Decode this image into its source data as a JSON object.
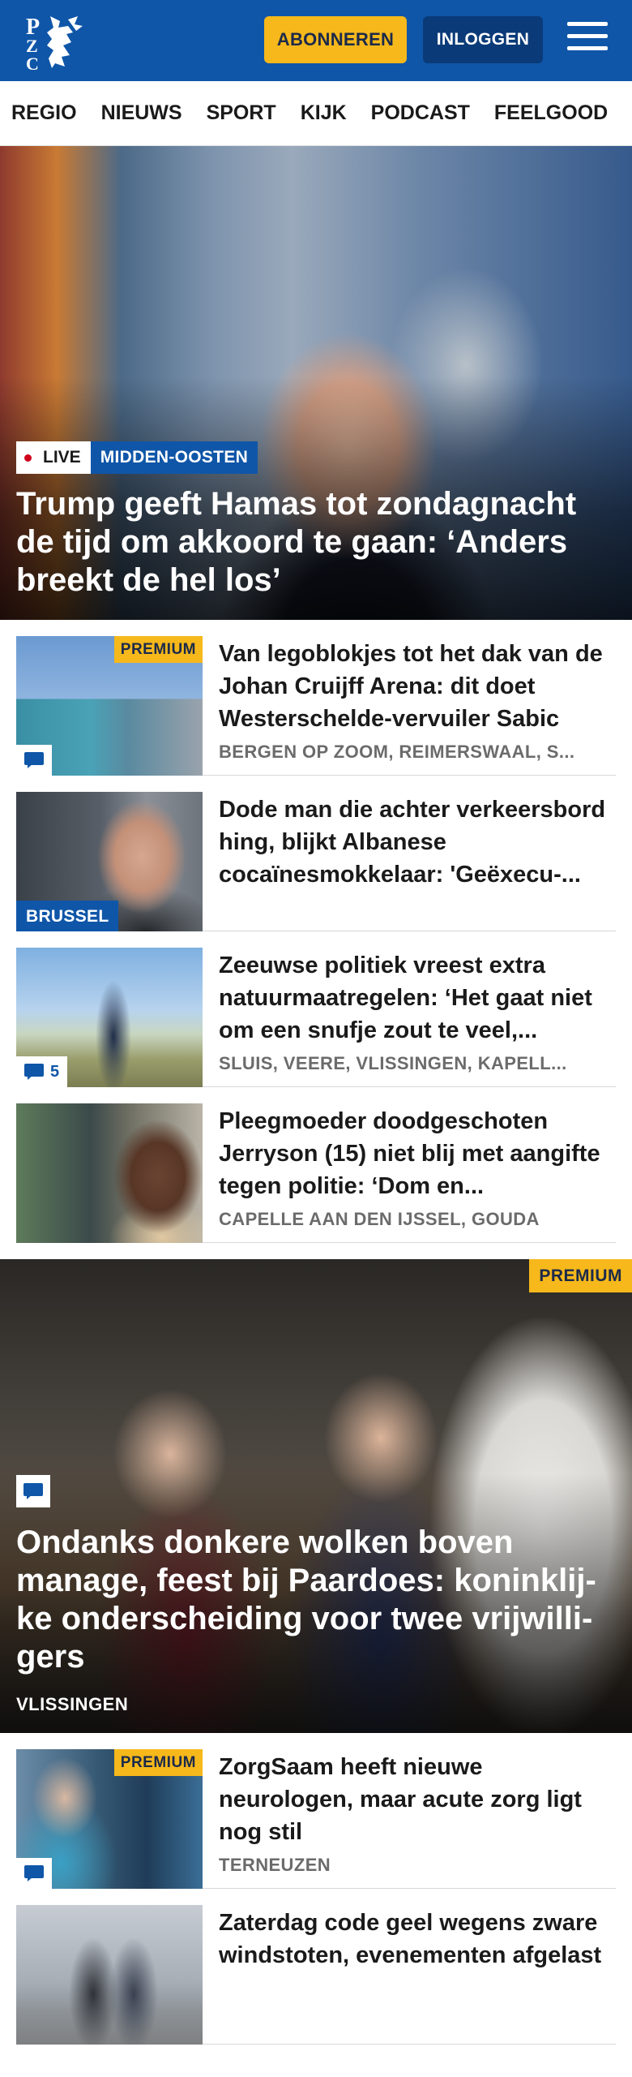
{
  "header": {
    "logo_alt": "PZC",
    "subscribe_label": "ABONNEREN",
    "login_label": "INLOGGEN"
  },
  "nav": {
    "items": [
      "REGIO",
      "NIEUWS",
      "SPORT",
      "KIJK",
      "PODCAST",
      "FEELGOOD"
    ]
  },
  "hero": {
    "live_label": "LIVE",
    "section_label": "MIDDEN-OOSTEN",
    "title": "Trump geeft Hamas tot zondagnacht de tijd om akkoord te gaan: ‘Anders breekt de hel los’"
  },
  "articles": [
    {
      "premium": "PREMIUM",
      "title": "Van legoblokjes tot het dak van de Johan Cruijff Arena: dit doet Westerschelde-vervuiler Sabic",
      "location": "BERGEN OP ZOOM, REIMERSWAAL, S..."
    },
    {
      "section": "BRUSSEL",
      "title": "Dode man die achter verkeers­bord hing, blijkt Albanese cocaïnesmokkelaar: 'Geëxecu-..."
    },
    {
      "comments": "5",
      "title": "Zeeuwse politiek vreest extra natuurmaatregelen: ‘Het gaat niet om een snufje zout te veel,...",
      "location": "SLUIS, VEERE, VLISSINGEN, KAPELL..."
    },
    {
      "title": "Pleegmoeder doodgeschoten Jerryson (15) niet blij met aangifte tegen politie: ‘Dom en...",
      "location": "CAPELLE AAN DEN IJSSEL, GOUDA"
    }
  ],
  "feature": {
    "premium": "PREMIUM",
    "title": "Ondanks donkere wolken boven manage, feest bij Paardoes: koninklij­ke onderscheiding voor twee vrijwilli­gers",
    "location": "VLISSINGEN"
  },
  "articles2": [
    {
      "premium": "PREMIUM",
      "title": "ZorgSaam heeft nieuwe neurologen, maar acute zorg ligt nog stil",
      "location": "TERNEUZEN"
    },
    {
      "title": "Zaterdag code geel wegens zware windstoten, evenementen afgelast"
    }
  ],
  "colors": {
    "brand_blue": "#0f56a8",
    "accent_yellow": "#f6b81b",
    "live_red": "#d0021b"
  }
}
